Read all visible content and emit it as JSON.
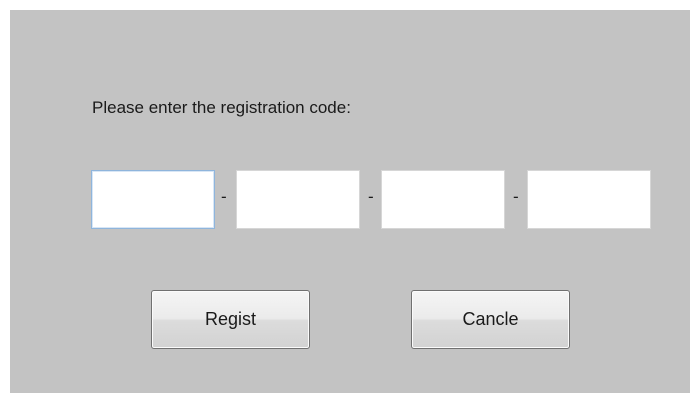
{
  "dialog": {
    "prompt": "Please enter the registration code:",
    "code_fields": [
      {
        "value": "",
        "focused": true
      },
      {
        "value": "",
        "focused": false
      },
      {
        "value": "",
        "focused": false
      },
      {
        "value": "",
        "focused": false
      }
    ],
    "separator": "-",
    "regist_label": "Regist",
    "cancel_label": "Cancle"
  }
}
